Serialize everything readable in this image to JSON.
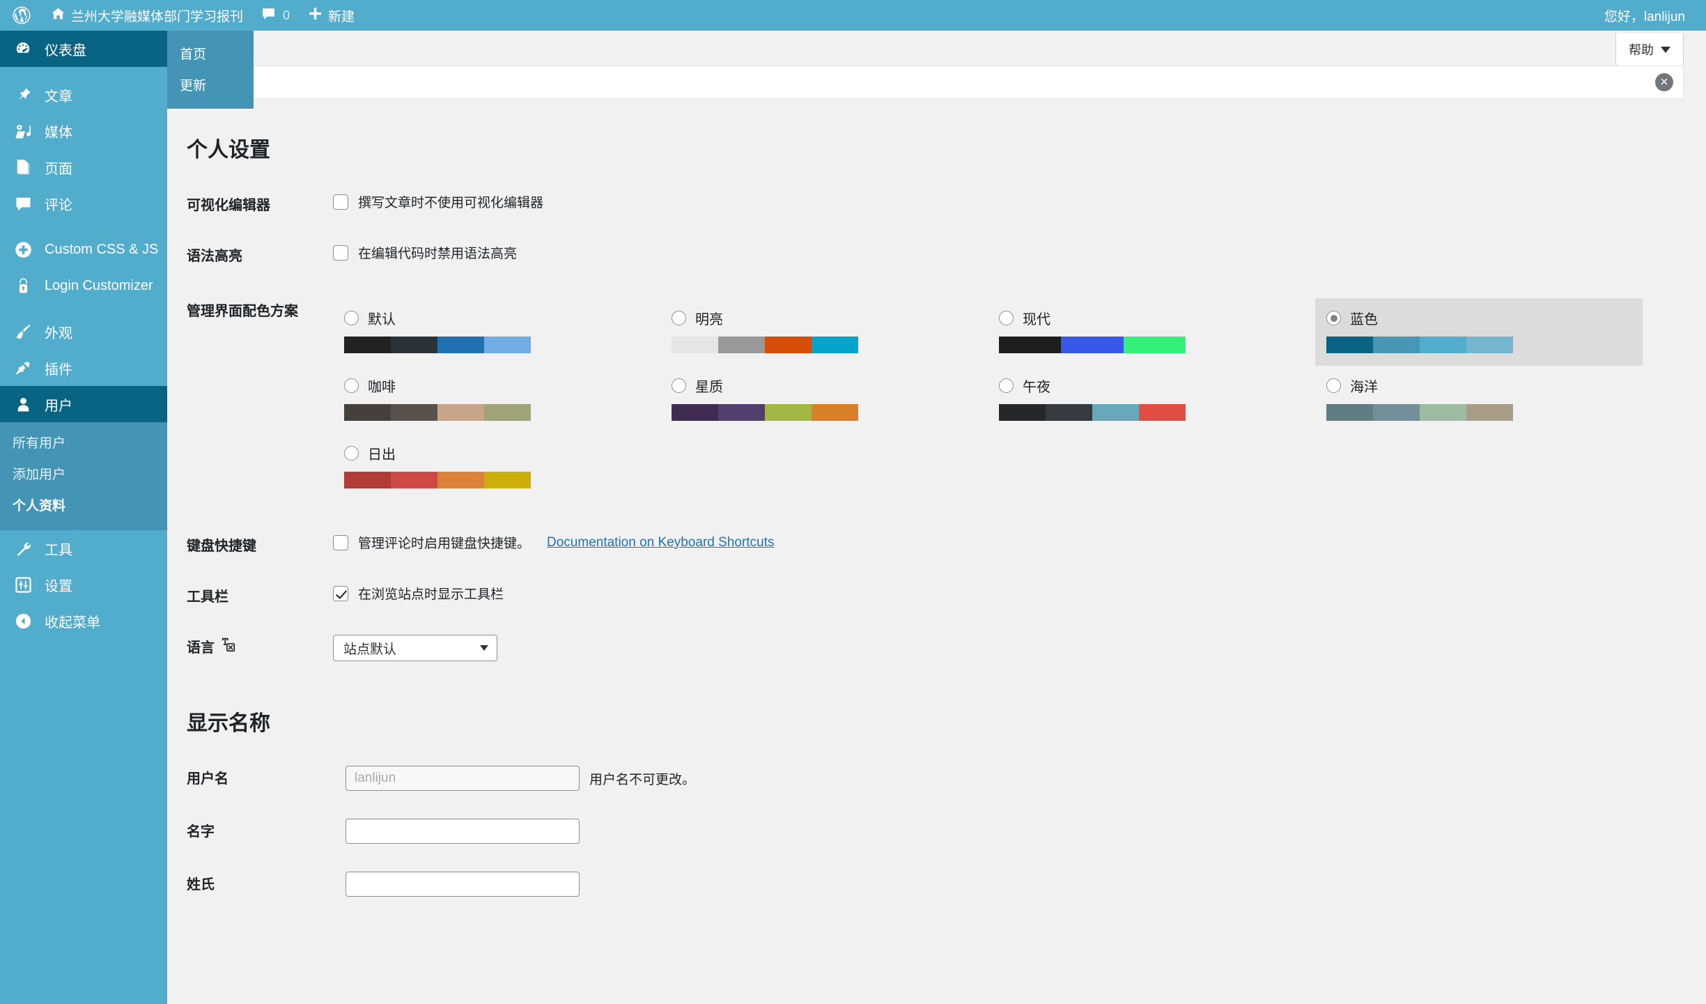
{
  "adminbar": {
    "wp_logo": "wordpress-logo",
    "site_name": "兰州大学融媒体部门学习报刊",
    "comments_count": "0",
    "new_label": "新建",
    "greeting": "您好，lanlijun"
  },
  "sidebar": {
    "items": [
      {
        "label": "仪表盘",
        "icon": "dashboard-icon",
        "current": true
      },
      {
        "label": "文章",
        "icon": "pin-icon",
        "current": false
      },
      {
        "label": "媒体",
        "icon": "media-icon",
        "current": false
      },
      {
        "label": "页面",
        "icon": "pages-icon",
        "current": false
      },
      {
        "label": "评论",
        "icon": "comment-icon",
        "current": false
      },
      {
        "label": "Custom CSS & JS",
        "icon": "plus-circle-icon",
        "current": false
      },
      {
        "label": "Login Customizer",
        "icon": "lock-icon",
        "current": false
      },
      {
        "label": "外观",
        "icon": "brush-icon",
        "current": false
      },
      {
        "label": "插件",
        "icon": "plug-icon",
        "current": false
      },
      {
        "label": "用户",
        "icon": "user-icon",
        "current": true
      }
    ],
    "users_submenu": [
      {
        "label": "所有用户",
        "current": false
      },
      {
        "label": "添加用户",
        "current": false
      },
      {
        "label": "个人资料",
        "current": true
      }
    ],
    "tail_items": [
      {
        "label": "工具",
        "icon": "wrench-icon"
      },
      {
        "label": "设置",
        "icon": "settings-icon"
      },
      {
        "label": "收起菜单",
        "icon": "collapse-icon"
      }
    ],
    "dashboard_flyout": [
      {
        "label": "首页"
      },
      {
        "label": "更新"
      }
    ]
  },
  "screen_meta": {
    "help_label": "帮助"
  },
  "notice": {
    "dismiss_icon": "dismiss-circle-icon"
  },
  "main": {
    "personal_options_title": "个人设置",
    "display_name_title": "显示名称",
    "rows": {
      "visual_editor": {
        "label": "可视化编辑器",
        "checkbox_label": "撰写文章时不使用可视化编辑器",
        "checked": false
      },
      "syntax_highlighting": {
        "label": "语法高亮",
        "checkbox_label": "在编辑代码时禁用语法高亮",
        "checked": false
      },
      "admin_color_scheme": {
        "label": "管理界面配色方案"
      },
      "keyboard_shortcuts": {
        "label": "键盘快捷键",
        "checkbox_label": "管理评论时启用键盘快捷键。",
        "doc_link": "Documentation on Keyboard Shortcuts",
        "checked": false
      },
      "toolbar": {
        "label": "工具栏",
        "checkbox_label": "在浏览站点时显示工具栏",
        "checked": true
      },
      "language": {
        "label": "语言",
        "icon": "translate-icon",
        "selected": "站点默认"
      },
      "username": {
        "label": "用户名",
        "value": "lanlijun",
        "note": "用户名不可更改。",
        "disabled": true
      },
      "first_name": {
        "label": "名字",
        "value": ""
      },
      "last_name": {
        "label": "姓氏",
        "value": ""
      }
    },
    "color_schemes": [
      {
        "name": "默认",
        "selected": false,
        "colors": [
          "#222222",
          "#2c3338",
          "#2071b1",
          "#72aee6"
        ]
      },
      {
        "name": "明亮",
        "selected": false,
        "colors": [
          "#e5e5e5",
          "#999999",
          "#d64e07",
          "#04a4cc"
        ]
      },
      {
        "name": "现代",
        "selected": false,
        "colors": [
          "#1e1e1e",
          "#3858e9",
          "#33f078"
        ]
      },
      {
        "name": "蓝色",
        "selected": true,
        "colors": [
          "#096484",
          "#4796b3",
          "#52accc",
          "#74b6ce"
        ]
      },
      {
        "name": "咖啡",
        "selected": false,
        "colors": [
          "#46403c",
          "#59524c",
          "#c7a589",
          "#9ea476"
        ]
      },
      {
        "name": "星质",
        "selected": false,
        "colors": [
          "#402b52",
          "#523f6d",
          "#a3b745",
          "#d97f27"
        ]
      },
      {
        "name": "午夜",
        "selected": false,
        "colors": [
          "#25282b",
          "#363b3f",
          "#69a8bb",
          "#e14d43"
        ]
      },
      {
        "name": "海洋",
        "selected": false,
        "colors": [
          "#627c83",
          "#738e96",
          "#9ebaa0",
          "#aa9d88"
        ]
      },
      {
        "name": "日出",
        "selected": false,
        "colors": [
          "#b43c38",
          "#cf4944",
          "#dd823b",
          "#ccaf0b"
        ]
      }
    ]
  }
}
